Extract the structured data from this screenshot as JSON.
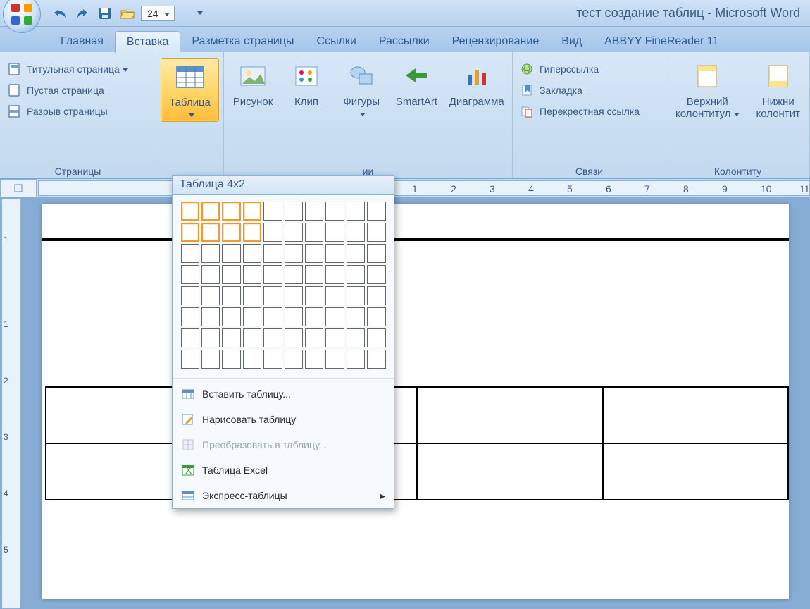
{
  "title": "тест создание таблиц - Microsoft Word",
  "qat": {
    "zoom": "24"
  },
  "tabs": {
    "items": [
      "Главная",
      "Вставка",
      "Разметка страницы",
      "Ссылки",
      "Рассылки",
      "Рецензирование",
      "Вид",
      "ABBYY FineReader 11"
    ],
    "active_index": 1
  },
  "ribbon": {
    "pages": {
      "label": "Страницы",
      "cover": "Титульная страница",
      "blank": "Пустая страница",
      "break": "Разрыв страницы"
    },
    "table_btn": "Таблица",
    "illustrations": {
      "label": "ии",
      "picture": "Рисунок",
      "clip": "Клип",
      "shapes": "Фигуры",
      "smartart": "SmartArt",
      "chart": "Диаграмма"
    },
    "links": {
      "label": "Связи",
      "hyperlink": "Гиперссылка",
      "bookmark": "Закладка",
      "crossref": "Перекрестная ссылка"
    },
    "header_footer": {
      "label": "Колонтиту",
      "header": "Верхний\nколонтитул",
      "footer": "Нижни\nколонтит"
    }
  },
  "table_popup": {
    "title": "Таблица 4x2",
    "selected": {
      "cols": 4,
      "rows": 2
    },
    "grid": {
      "cols": 10,
      "rows": 8
    },
    "menu_insert": "Вставить таблицу...",
    "menu_draw": "Нарисовать таблицу",
    "menu_convert": "Преобразовать в таблицу...",
    "menu_excel": "Таблица Excel",
    "menu_quick": "Экспресс-таблицы"
  },
  "hruler_numbers": [
    "1",
    "2",
    "3",
    "4",
    "5",
    "6",
    "7",
    "8",
    "9",
    "10",
    "11"
  ],
  "vruler_numbers": [
    "1",
    "1",
    "2",
    "3",
    "4",
    "5"
  ]
}
